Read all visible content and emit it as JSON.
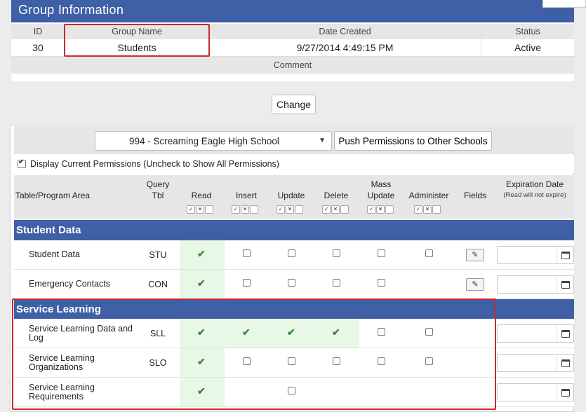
{
  "group_info": {
    "title": "Group Information",
    "headers": {
      "id": "ID",
      "group_name": "Group Name",
      "date_created": "Date Created",
      "status": "Status"
    },
    "values": {
      "id": "30",
      "group_name": "Students",
      "date_created": "9/27/2014 4:49:15 PM",
      "status": "Active"
    },
    "comment_label": "Comment",
    "change_label": "Change"
  },
  "permissions": {
    "school_select": "994 - Screaming Eagle High School",
    "push_button": "Push Permissions to Other Schools",
    "display_current_label": "Display Current Permissions (Uncheck to Show All Permissions)",
    "display_current_checked": true,
    "columns": {
      "area": "Table/Program Area",
      "query_1": "Query",
      "query_2": "Tbl",
      "read": "Read",
      "insert": "Insert",
      "update": "Update",
      "delete": "Delete",
      "mass_1": "Mass",
      "mass_2": "Update",
      "administer": "Administer",
      "fields": "Fields",
      "expiration": "Expiration Date",
      "expiration_note": "(Read will not expire)"
    },
    "sections": [
      {
        "title": "Student Data",
        "rows": [
          {
            "label": "Student Data",
            "tbl": "STU"
          },
          {
            "label": "Emergency Contacts",
            "tbl": "CON"
          }
        ]
      },
      {
        "title": "Service Learning",
        "rows": [
          {
            "label": "Service Learning Data and Log",
            "tbl": "SLL"
          },
          {
            "label": "Service Learning Organizations",
            "tbl": "SLO"
          },
          {
            "label": "Service Learning Requirements",
            "tbl": ""
          }
        ]
      }
    ]
  },
  "icons": {
    "check": "check-icon",
    "dropdown": "chevron-down-icon",
    "fields": "edit-icon",
    "calendar": "calendar-icon"
  },
  "colors": {
    "header_blue": "#3f5fa6",
    "highlight_red": "#cc2a2a",
    "granted_green": "#e8f8e6",
    "check_green": "#3a8a38"
  }
}
